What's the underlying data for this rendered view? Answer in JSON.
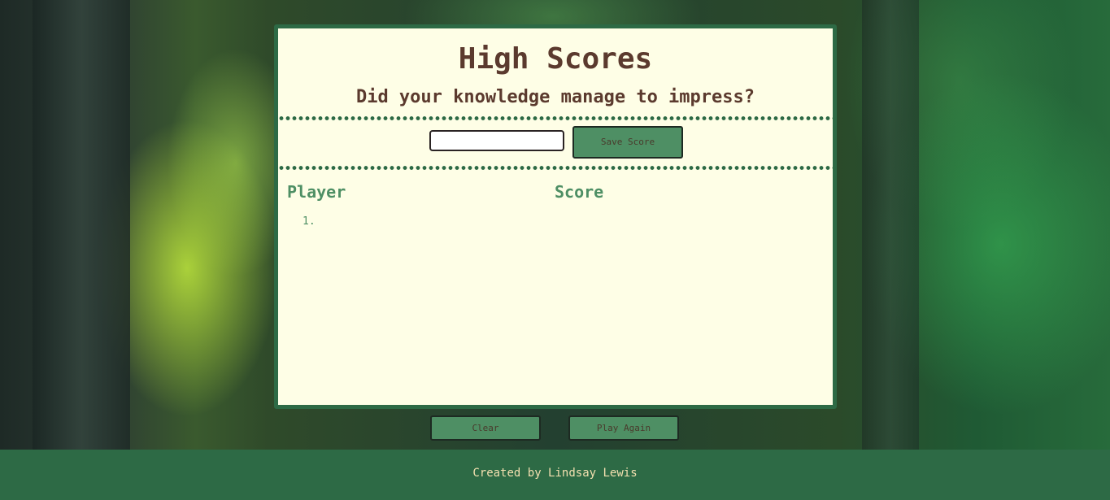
{
  "page": {
    "title": "High Scores",
    "subtitle": "Did your knowledge manage to impress?"
  },
  "form": {
    "initials_value": "",
    "save_label": "Save Score"
  },
  "scoreboard": {
    "player_header": "Player",
    "score_header": "Score",
    "entries": [
      {
        "rank": "1.",
        "player": "",
        "score": ""
      }
    ]
  },
  "actions": {
    "clear_label": "Clear",
    "play_again_label": "Play Again"
  },
  "footer": {
    "credit": "Created by Lindsay Lewis"
  },
  "colors": {
    "primary_green": "#2d6a45",
    "button_green": "#4e8f64",
    "card_background": "#fefee6",
    "heading_brown": "#5b3a2e",
    "footer_text": "#f3e0b0"
  }
}
